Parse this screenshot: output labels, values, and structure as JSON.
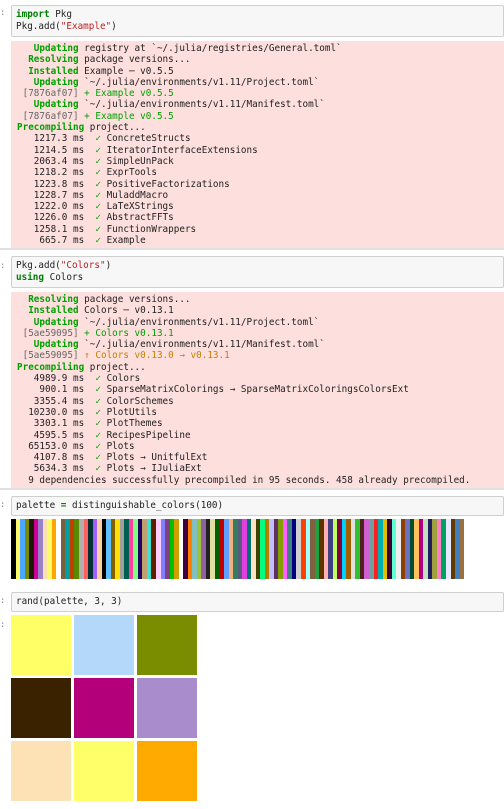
{
  "cells": [
    {
      "prompt": ":",
      "input": [
        [
          {
            "t": "import",
            "c": "kw"
          },
          {
            "t": " Pkg",
            "c": ""
          }
        ],
        [
          {
            "t": "Pkg.add(",
            "c": ""
          },
          {
            "t": "\"Example\"",
            "c": "str"
          },
          {
            "t": ")",
            "c": ""
          }
        ]
      ]
    },
    {
      "prompt": ":",
      "input": [
        [
          {
            "t": "Pkg.add(",
            "c": ""
          },
          {
            "t": "\"Colors\"",
            "c": "str"
          },
          {
            "t": ")",
            "c": ""
          }
        ],
        [
          {
            "t": "using",
            "c": "kw"
          },
          {
            "t": " Colors",
            "c": ""
          }
        ]
      ]
    },
    {
      "prompt": ":",
      "input": [
        [
          {
            "t": "palette ",
            "c": ""
          },
          {
            "t": "=",
            "c": "kw"
          },
          {
            "t": " distinguishable_colors(100)",
            "c": ""
          }
        ]
      ]
    },
    {
      "prompt": ":",
      "input": [
        [
          {
            "t": "rand(palette, 3, 3)",
            "c": ""
          }
        ]
      ]
    }
  ],
  "output1": [
    [
      {
        "t": "   Updating",
        "c": "g"
      },
      {
        "t": " registry at `~/.julia/registries/General.toml`",
        "c": ""
      }
    ],
    [
      {
        "t": "  Resolving",
        "c": "g"
      },
      {
        "t": " package versions...",
        "c": ""
      }
    ],
    [
      {
        "t": "  Installed",
        "c": "g"
      },
      {
        "t": " Example ─ v0.5.5",
        "c": ""
      }
    ],
    [
      {
        "t": "   Updating",
        "c": "g"
      },
      {
        "t": " `~/.julia/environments/v1.11/Project.toml`",
        "c": ""
      }
    ],
    [
      {
        "t": " [7876af07]",
        "c": "dim"
      },
      {
        "t": " + Example v0.5.5",
        "c": "gr"
      }
    ],
    [
      {
        "t": "   Updating",
        "c": "g"
      },
      {
        "t": " `~/.julia/environments/v1.11/Manifest.toml`",
        "c": ""
      }
    ],
    [
      {
        "t": " [7876af07]",
        "c": "dim"
      },
      {
        "t": " + Example v0.5.5",
        "c": "gr"
      }
    ],
    [
      {
        "t": "Precompiling",
        "c": "g"
      },
      {
        "t": " project...",
        "c": ""
      }
    ],
    [
      {
        "t": "   1217.3 ms  ",
        "c": ""
      },
      {
        "t": "✓",
        "c": "gr"
      },
      {
        "t": " ConcreteStructs",
        "c": ""
      }
    ],
    [
      {
        "t": "   1214.5 ms  ",
        "c": ""
      },
      {
        "t": "✓",
        "c": "gr"
      },
      {
        "t": " IteratorInterfaceExtensions",
        "c": ""
      }
    ],
    [
      {
        "t": "   2063.4 ms  ",
        "c": ""
      },
      {
        "t": "✓",
        "c": "gr"
      },
      {
        "t": " SimpleUnPack",
        "c": ""
      }
    ],
    [
      {
        "t": "   1218.2 ms  ",
        "c": ""
      },
      {
        "t": "✓",
        "c": "gr"
      },
      {
        "t": " ExprTools",
        "c": ""
      }
    ],
    [
      {
        "t": "   1223.8 ms  ",
        "c": ""
      },
      {
        "t": "✓",
        "c": "gr"
      },
      {
        "t": " PositiveFactorizations",
        "c": ""
      }
    ],
    [
      {
        "t": "   1228.7 ms  ",
        "c": ""
      },
      {
        "t": "✓",
        "c": "gr"
      },
      {
        "t": " MuladdMacro",
        "c": ""
      }
    ],
    [
      {
        "t": "   1222.0 ms  ",
        "c": ""
      },
      {
        "t": "✓",
        "c": "gr"
      },
      {
        "t": " LaTeXStrings",
        "c": ""
      }
    ],
    [
      {
        "t": "   1226.0 ms  ",
        "c": ""
      },
      {
        "t": "✓",
        "c": "gr"
      },
      {
        "t": " AbstractFFTs",
        "c": ""
      }
    ],
    [
      {
        "t": "   1258.1 ms  ",
        "c": ""
      },
      {
        "t": "✓",
        "c": "gr"
      },
      {
        "t": " FunctionWrappers",
        "c": ""
      }
    ],
    [
      {
        "t": "    665.7 ms  ",
        "c": ""
      },
      {
        "t": "✓",
        "c": "gr"
      },
      {
        "t": " Example",
        "c": ""
      }
    ]
  ],
  "output2": [
    [
      {
        "t": "  Resolving",
        "c": "g"
      },
      {
        "t": " package versions...",
        "c": ""
      }
    ],
    [
      {
        "t": "  Installed",
        "c": "g"
      },
      {
        "t": " Colors ─ v0.13.1",
        "c": ""
      }
    ],
    [
      {
        "t": "   Updating",
        "c": "g"
      },
      {
        "t": " `~/.julia/environments/v1.11/Project.toml`",
        "c": ""
      }
    ],
    [
      {
        "t": " [5ae59095]",
        "c": "dim"
      },
      {
        "t": " + Colors v0.13.1",
        "c": "gr"
      }
    ],
    [
      {
        "t": "   Updating",
        "c": "g"
      },
      {
        "t": " `~/.julia/environments/v1.11/Manifest.toml`",
        "c": ""
      }
    ],
    [
      {
        "t": " [5ae59095]",
        "c": "dim"
      },
      {
        "t": " ↑ Colors v0.13.0 → v0.13.1",
        "c": "or"
      }
    ],
    [
      {
        "t": "Precompiling",
        "c": "g"
      },
      {
        "t": " project...",
        "c": ""
      }
    ],
    [
      {
        "t": "   4989.9 ms  ",
        "c": ""
      },
      {
        "t": "✓",
        "c": "gr"
      },
      {
        "t": " Colors",
        "c": ""
      }
    ],
    [
      {
        "t": "    900.1 ms  ",
        "c": ""
      },
      {
        "t": "✓",
        "c": "gr"
      },
      {
        "t": " SparseMatrixColorings → SparseMatrixColoringsColorsExt",
        "c": ""
      }
    ],
    [
      {
        "t": "   3355.4 ms  ",
        "c": ""
      },
      {
        "t": "✓",
        "c": "gr"
      },
      {
        "t": " ColorSchemes",
        "c": ""
      }
    ],
    [
      {
        "t": "  10230.0 ms  ",
        "c": ""
      },
      {
        "t": "✓",
        "c": "gr"
      },
      {
        "t": " PlotUtils",
        "c": ""
      }
    ],
    [
      {
        "t": "   3303.1 ms  ",
        "c": ""
      },
      {
        "t": "✓",
        "c": "gr"
      },
      {
        "t": " PlotThemes",
        "c": ""
      }
    ],
    [
      {
        "t": "   4595.5 ms  ",
        "c": ""
      },
      {
        "t": "✓",
        "c": "gr"
      },
      {
        "t": " RecipesPipeline",
        "c": ""
      }
    ],
    [
      {
        "t": "  65153.0 ms  ",
        "c": ""
      },
      {
        "t": "✓",
        "c": "gr"
      },
      {
        "t": " Plots",
        "c": ""
      }
    ],
    [
      {
        "t": "   4107.8 ms  ",
        "c": ""
      },
      {
        "t": "✓",
        "c": "gr"
      },
      {
        "t": " Plots → UnitfulExt",
        "c": ""
      }
    ],
    [
      {
        "t": "   5634.3 ms  ",
        "c": ""
      },
      {
        "t": "✓",
        "c": "gr"
      },
      {
        "t": " Plots → IJuliaExt",
        "c": ""
      }
    ],
    [
      {
        "t": "  9 dependencies successfully precompiled in 95 seconds. 458 already precompiled.",
        "c": ""
      }
    ]
  ],
  "palette": [
    "#000000",
    "#fcfc6a",
    "#4da6ff",
    "#7a8a00",
    "#1a1a00",
    "#cc0099",
    "#9a80c8",
    "#fde0b0",
    "#fcfc6a",
    "#ffa500",
    "#ffffff",
    "#7a6040",
    "#00a0a0",
    "#c04000",
    "#5a8a00",
    "#b0b0b0",
    "#ff6060",
    "#003030",
    "#a060ff",
    "#fcd0a0",
    "#000000",
    "#60c0ff",
    "#806000",
    "#ffe000",
    "#a0a0a0",
    "#006050",
    "#ff40a0",
    "#80ff80",
    "#200060",
    "#c0a070",
    "#40e0d0",
    "#602000",
    "#ffd0ff",
    "#8080ff",
    "#804080",
    "#00c000",
    "#d0a000",
    "#ffffff",
    "#400040",
    "#ff8000",
    "#80c0c0",
    "#a0c040",
    "#9060a0",
    "#202020",
    "#e0e0a0",
    "#006000",
    "#c00000",
    "#60a0ff",
    "#f0b080",
    "#308060",
    "#5a5a80",
    "#e040e0",
    "#007070",
    "#ffe0c0",
    "#404000",
    "#00ff80",
    "#b08000",
    "#c0c0ff",
    "#603060",
    "#80a000",
    "#ff60ff",
    "#408080",
    "#000080",
    "#d0d0d0",
    "#ff4000",
    "#a0ffff",
    "#806040",
    "#20a040",
    "#603000",
    "#ffb0b0",
    "#404080",
    "#c0ff60",
    "#800040",
    "#00d0ff",
    "#a06000",
    "#e0e0e0",
    "#30c030",
    "#502020",
    "#d060d0",
    "#70a0a0",
    "#ff2020",
    "#00b0b0",
    "#e0c000",
    "#3a0030",
    "#60ffd0",
    "#f0f0f0",
    "#8a4000",
    "#7070c0",
    "#005030",
    "#ffc060",
    "#b00080",
    "#c0e0c0",
    "#202060",
    "#a0a040",
    "#ff80c0",
    "#00a060",
    "#e8e8ff",
    "#603a00",
    "#4080c0",
    "#9a7040"
  ],
  "grid": [
    "#ffff66",
    "#b3d8fa",
    "#7a8c00",
    "#3a2200",
    "#b3007a",
    "#a98ccc",
    "#fde2b6",
    "#ffff6a",
    "#ffaa00"
  ]
}
